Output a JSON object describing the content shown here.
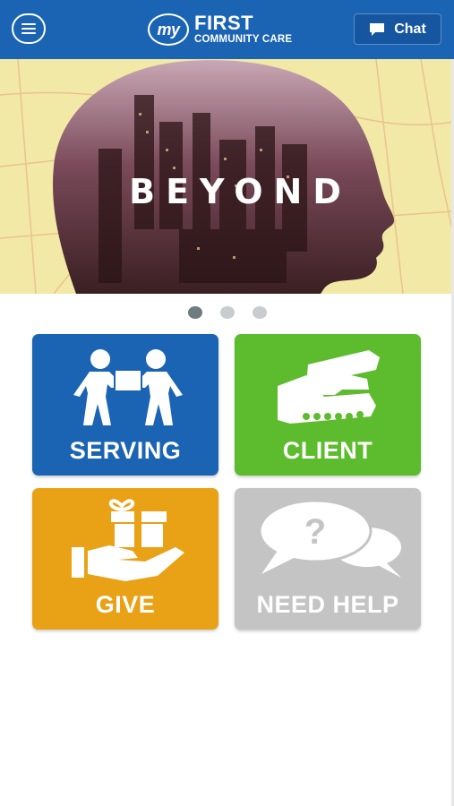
{
  "header": {
    "logo_my": "my",
    "logo_first": "FIRST",
    "logo_sub": "COMMUNITY CARE",
    "chat_label": "Chat"
  },
  "hero": {
    "word": "BEYOND"
  },
  "carousel": {
    "slides": 3,
    "active": 1
  },
  "tiles": [
    {
      "label": "SERVING",
      "icon": "people-carrying-box-icon",
      "color": "#1b64b3"
    },
    {
      "label": "CLIENT",
      "icon": "handshake-icon",
      "color": "#5dbb2e"
    },
    {
      "label": "GIVE",
      "icon": "gift-in-hand-icon",
      "color": "#e9a116"
    },
    {
      "label": "NEED HELP",
      "icon": "question-speech-bubbles-icon",
      "color": "#c4c4c4"
    }
  ],
  "colors": {
    "brand_blue": "#1b64b3",
    "hero_bg": "#f3e9a6"
  }
}
